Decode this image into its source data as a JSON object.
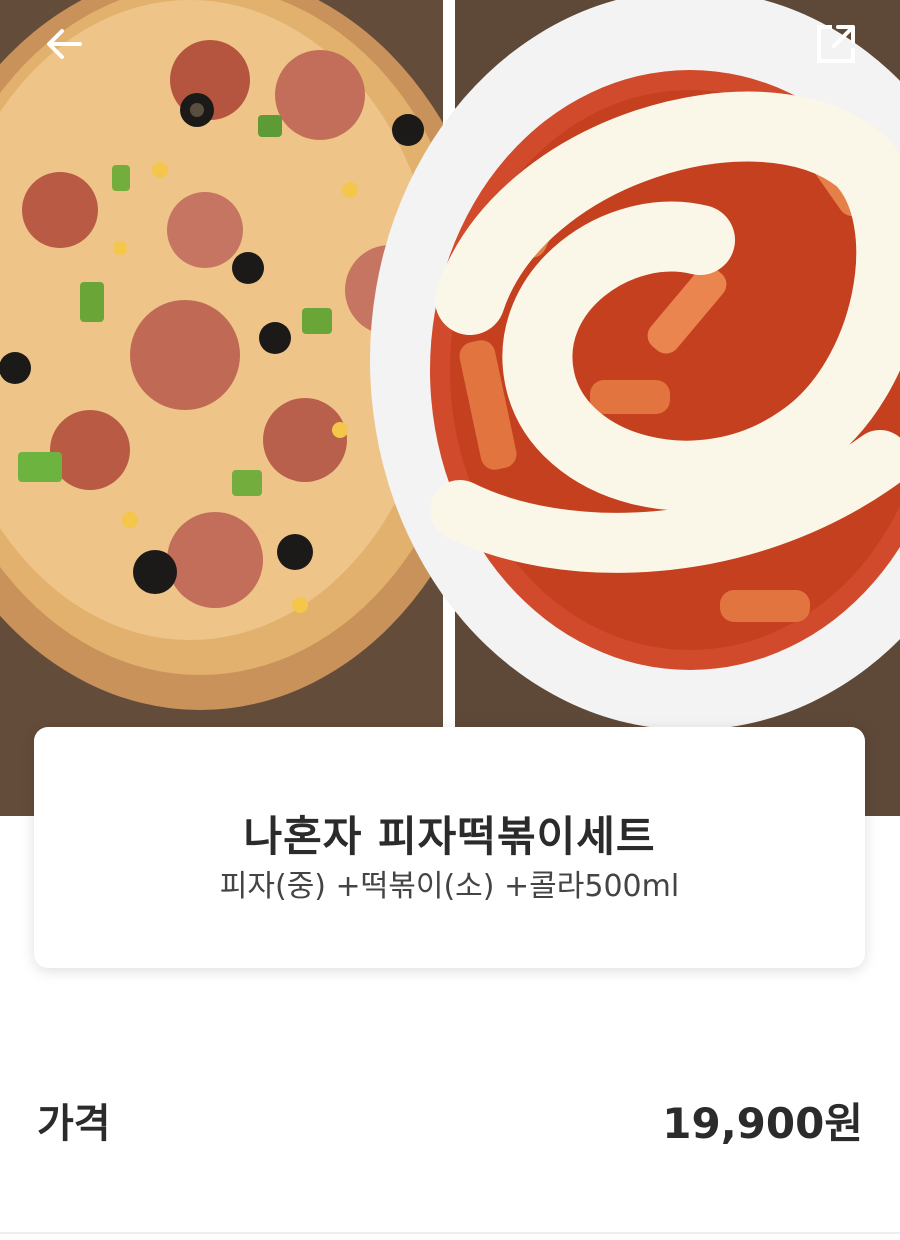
{
  "product": {
    "title": "나혼자 피자떡볶이세트",
    "description": "피자(중) +떡볶이(소) +콜라500ml"
  },
  "price": {
    "label": "가격",
    "value": "19,900원"
  },
  "toolbar": {
    "back_icon": "arrow-left-icon",
    "share_icon": "external-link-icon"
  },
  "images": [
    "pizza-photo",
    "tteokbokki-photo"
  ]
}
